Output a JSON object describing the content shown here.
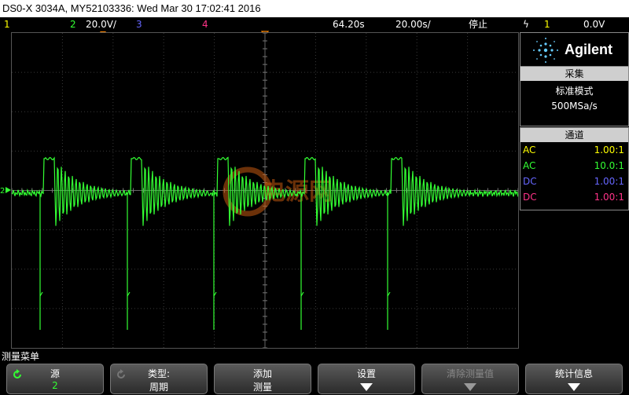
{
  "title_bar": {
    "text": "DS0-X 3034A, MY52103336: Wed Mar 30 17:02:41 2016"
  },
  "status_bar": {
    "ch1": "1",
    "ch2": "2",
    "ch2_scale": "20.0V/",
    "ch3": "3",
    "ch4": "4",
    "trigger_delay": "64.20s",
    "timebase": "20.00s/",
    "run_state": "停止",
    "trigger_source": "1",
    "trigger_level": "0.0V"
  },
  "brand": {
    "name": "Agilent"
  },
  "acquire": {
    "header": "采集",
    "mode": "标准模式",
    "rate": "500MSa/s"
  },
  "channels": {
    "header": "通道",
    "rows": [
      {
        "coupling": "AC",
        "ratio": "1.00:1",
        "color": "#ffff00"
      },
      {
        "coupling": "AC",
        "ratio": "10.0:1",
        "color": "#33ff33"
      },
      {
        "coupling": "DC",
        "ratio": "1.00:1",
        "color": "#6666ff"
      },
      {
        "coupling": "DC",
        "ratio": "1.00:1",
        "color": "#ff3388"
      }
    ]
  },
  "menu_title": "测量菜单",
  "softkeys": [
    {
      "line1": "源",
      "line2": "2"
    },
    {
      "line1": "类型:",
      "line2": "周期"
    },
    {
      "line1": "添加",
      "line2": "测量"
    },
    {
      "line1": "设置",
      "line2": ""
    },
    {
      "line1": "清除测量值",
      "line2": ""
    },
    {
      "line1": "统计信息",
      "line2": ""
    }
  ],
  "watermark": {
    "text": "电源网"
  },
  "colors": {
    "ch1": "#ffff00",
    "ch2": "#33ff33",
    "ch3": "#6666ff",
    "ch4": "#ff3388",
    "trigger_marker": "#ff8800"
  }
}
